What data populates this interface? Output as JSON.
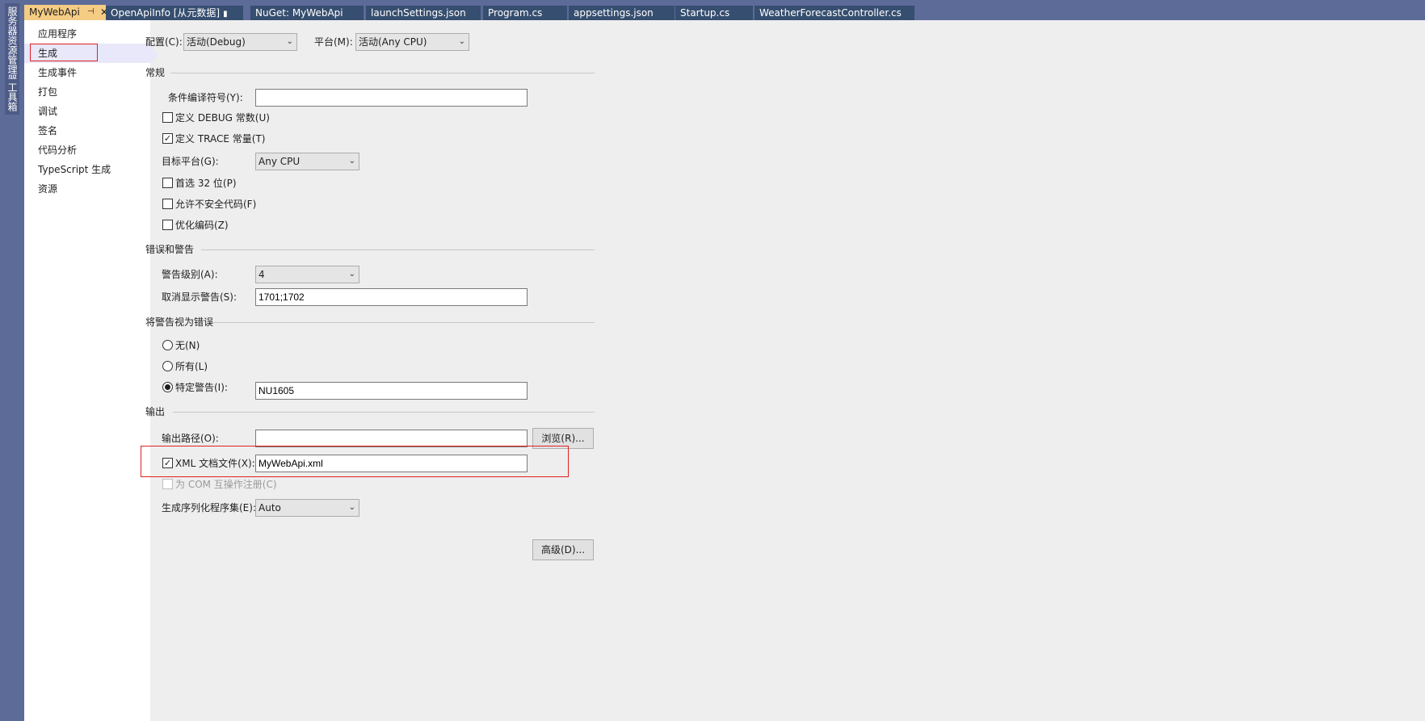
{
  "side_tabs": {
    "server_explorer": "服务器资源管理器",
    "toolbox": "工具箱"
  },
  "tabs": [
    {
      "label": "MyWebApi"
    },
    {
      "label": "OpenApiInfo [从元数据]"
    },
    {
      "label": "NuGet: MyWebApi"
    },
    {
      "label": "launchSettings.json"
    },
    {
      "label": "Program.cs"
    },
    {
      "label": "appsettings.json"
    },
    {
      "label": "Startup.cs"
    },
    {
      "label": "WeatherForecastController.cs"
    }
  ],
  "icons": {
    "pin": "pin-icon",
    "close": "close-icon",
    "lock": "lock-icon",
    "dropdown": "chevron-down-icon"
  },
  "nav": [
    {
      "label": "应用程序"
    },
    {
      "label": "生成"
    },
    {
      "label": "生成事件"
    },
    {
      "label": "打包"
    },
    {
      "label": "调试"
    },
    {
      "label": "签名"
    },
    {
      "label": "代码分析"
    },
    {
      "label": "TypeScript 生成"
    },
    {
      "label": "资源"
    }
  ],
  "nav_selected": "生成",
  "config": {
    "label": "配置(C):",
    "value": "活动(Debug)"
  },
  "platform": {
    "label": "平台(M):",
    "value": "活动(Any CPU)"
  },
  "general": {
    "title": "常规",
    "conditional_symbols": {
      "label": "条件编译符号(Y):",
      "value": ""
    },
    "define_debug": {
      "label": "定义 DEBUG 常数(U)",
      "checked": false
    },
    "define_trace": {
      "label": "定义 TRACE 常量(T)",
      "checked": true
    },
    "target_platform": {
      "label": "目标平台(G):",
      "value": "Any CPU"
    },
    "prefer32": {
      "label": "首选 32 位(P)",
      "checked": false
    },
    "unsafe": {
      "label": "允许不安全代码(F)",
      "checked": false
    },
    "optimize": {
      "label": "优化编码(Z)",
      "checked": false
    }
  },
  "errors": {
    "title": "错误和警告",
    "warning_level": {
      "label": "警告级别(A):",
      "value": "4"
    },
    "suppress": {
      "label": "取消显示警告(S):",
      "value": "1701;1702"
    }
  },
  "treat_warnings": {
    "title": "将警告视为错误",
    "none": {
      "label": "无(N)",
      "selected": false
    },
    "all": {
      "label": "所有(L)",
      "selected": false
    },
    "specific": {
      "label": "特定警告(I):",
      "selected": true,
      "value": "NU1605"
    }
  },
  "output": {
    "title": "输出",
    "path": {
      "label": "输出路径(O):",
      "value": "",
      "browse": "浏览(R)..."
    },
    "xml_doc": {
      "label": "XML 文档文件(X):",
      "checked": true,
      "value": "MyWebApi.xml"
    },
    "com": {
      "label": "为 COM 互操作注册(C)",
      "checked": false,
      "enabled": false
    },
    "serialization": {
      "label": "生成序列化程序集(E):",
      "value": "Auto"
    }
  },
  "advanced_button": "高级(D)...",
  "colors": {
    "active_tab": "#f5cc84",
    "tab_bg": "#364e6f",
    "chrome": "#5d6b99",
    "highlight": "#e02020",
    "nav_selected": "#e8e8fa",
    "page_bg": "#eeeeee"
  }
}
